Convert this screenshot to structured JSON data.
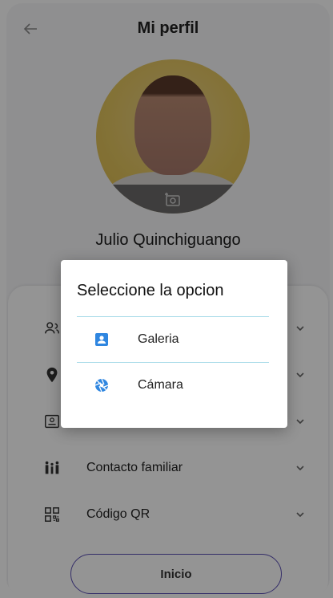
{
  "header": {
    "title": "Mi perfil",
    "back_icon": "arrow-left-icon"
  },
  "profile": {
    "name": "Julio Quinchiguango",
    "camera_icon": "add-photo-icon"
  },
  "menu": {
    "items": [
      {
        "label": "",
        "icon": "people-icon"
      },
      {
        "label": "",
        "icon": "location-pin-icon"
      },
      {
        "label": "",
        "icon": "id-card-icon"
      },
      {
        "label": "Contacto familiar",
        "icon": "family-icon"
      },
      {
        "label": "Código QR",
        "icon": "qr-code-icon"
      }
    ],
    "home_button": "Inicio"
  },
  "dialog": {
    "title": "Seleccione la opcion",
    "options": [
      {
        "label": "Galeria",
        "icon": "contact-card-icon",
        "color": "#2f86e0"
      },
      {
        "label": "Cámara",
        "icon": "camera-aperture-icon",
        "color": "#2f86e0"
      }
    ],
    "divider_color": "#a8dbe8"
  },
  "colors": {
    "accent": "#5b4fb4",
    "overlay": "rgba(0,0,0,0.42)"
  }
}
